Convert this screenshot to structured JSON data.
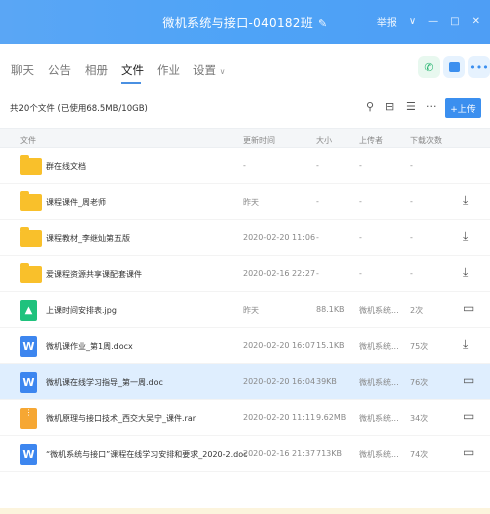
{
  "window": {
    "title": "微机系统与接口-040182班",
    "controls": [
      "举报",
      "∨",
      "—",
      "□",
      "✕"
    ]
  },
  "tabs": [
    {
      "label": "聊天"
    },
    {
      "label": "公告"
    },
    {
      "label": "相册"
    },
    {
      "label": "文件",
      "active": true
    },
    {
      "label": "作业"
    },
    {
      "label": "设置"
    }
  ],
  "toolbar": {
    "stats": "共20个文件 (已使用68.5MB/10GB)",
    "upload_label": "+上传"
  },
  "table": {
    "headers": {
      "name": "文件",
      "modified": "更新时间",
      "size": "大小",
      "uploader": "上传者",
      "downloads": "下载次数"
    },
    "rows": [
      {
        "icon": "folder",
        "name": "群在线文档",
        "modified": "-",
        "size": "-",
        "uploader": "-",
        "downloads": "-",
        "action": ""
      },
      {
        "icon": "folder",
        "name": "课程课件_周老师",
        "modified": "昨天",
        "size": "-",
        "uploader": "-",
        "downloads": "-",
        "action": "download"
      },
      {
        "icon": "folder",
        "name": "课程教材_李继灿第五版",
        "modified": "2020-02-20 11:06",
        "size": "-",
        "uploader": "-",
        "downloads": "-",
        "action": "download"
      },
      {
        "icon": "folder",
        "name": "爱课程资源共享课配套课件",
        "modified": "2020-02-16 22:27",
        "size": "-",
        "uploader": "-",
        "downloads": "-",
        "action": "download"
      },
      {
        "icon": "image",
        "name": "上课时间安排表.jpg",
        "modified": "昨天",
        "size": "88.1KB",
        "uploader": "微机系统...",
        "downloads": "2次",
        "action": "folder"
      },
      {
        "icon": "word",
        "name": "微机课作业_第1周.docx",
        "modified": "2020-02-20 16:07",
        "size": "15.1KB",
        "uploader": "微机系统...",
        "downloads": "75次",
        "action": "download"
      },
      {
        "icon": "word",
        "name": "微机课在线学习指导_第一周.doc",
        "modified": "2020-02-20 16:04",
        "size": "39KB",
        "uploader": "微机系统...",
        "downloads": "76次",
        "action": "folder",
        "selected": true
      },
      {
        "icon": "zip",
        "name": "微机原理与接口技术_西交大吴宁_课件.rar",
        "modified": "2020-02-20 11:11",
        "size": "9.62MB",
        "uploader": "微机系统...",
        "downloads": "34次",
        "action": "folder"
      },
      {
        "icon": "word",
        "name": "“微机系统与接口”课程在线学习安排和要求_2020-2.doc",
        "modified": "2020-02-16 21:37",
        "size": "713KB",
        "uploader": "微机系统...",
        "downloads": "74次",
        "action": "folder"
      }
    ]
  },
  "colors": {
    "titlebar": "#4ea3f7",
    "accent": "#3b8fef",
    "selected_row": "#dfeefe",
    "folder": "#f9c02b",
    "word": "#3d86ef",
    "image": "#1fc27d",
    "zip": "#f6a733"
  }
}
